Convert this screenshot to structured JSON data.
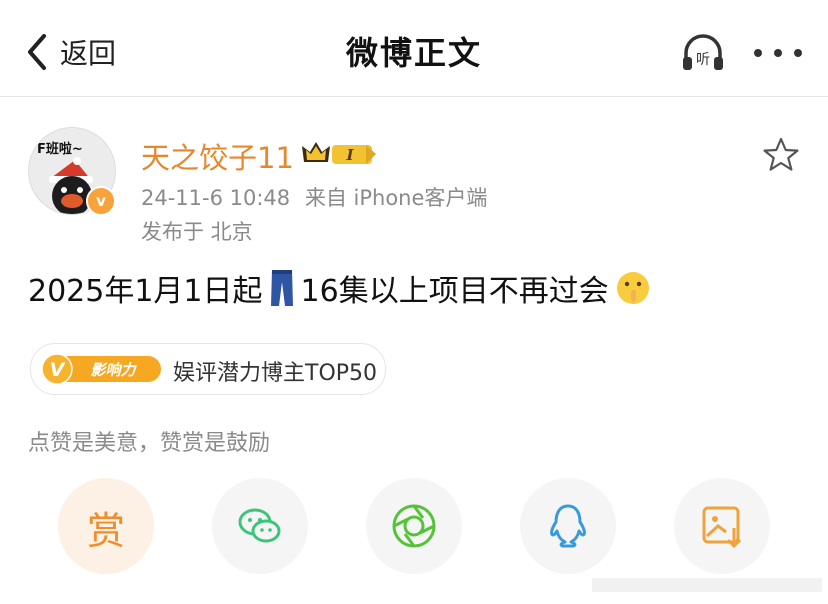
{
  "nav": {
    "back_label": "返回",
    "title": "微博正文"
  },
  "post": {
    "username": "天之饺子11",
    "vip_level": "I",
    "timestamp": "24-11-6 10:48",
    "source": "来自 iPhone客户端",
    "location": "发布于 北京",
    "text_part1": "2025年1月1日起",
    "text_part2": "16集以上项目不再过会",
    "avatar_caption": "F班啦~",
    "verified_icon": "v-badge-icon"
  },
  "influence": {
    "badge_text": "影响力",
    "label": "娱评潜力博主TOP50"
  },
  "tip": "点赞是美意，赞赏是鼓励",
  "share": {
    "reward_label": "赏"
  },
  "colors": {
    "accent": "#e8862c",
    "reward": "#f08c2c",
    "wechat": "#3cc57a",
    "moments": "#55c23a",
    "qq": "#3a9ad9",
    "save": "#f0a23c"
  }
}
